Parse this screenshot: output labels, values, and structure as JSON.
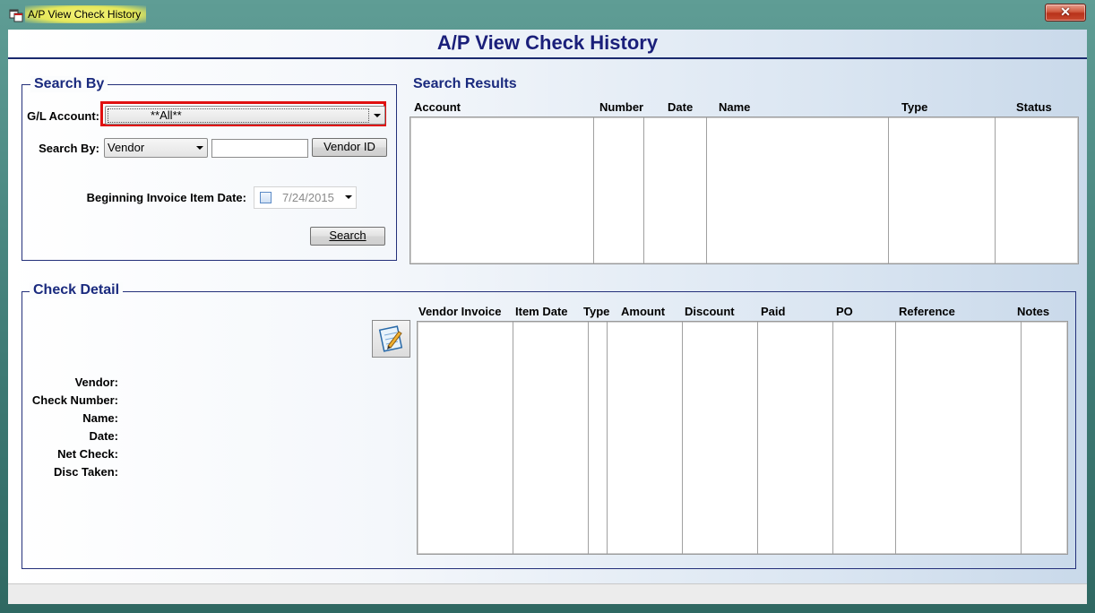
{
  "window": {
    "title": "A/P View Check History",
    "close_label": "✕",
    "close_icon": "close-icon",
    "app_icon": "window-icon"
  },
  "page": {
    "title": "A/P View Check History"
  },
  "search_by": {
    "group_title": "Search By",
    "gl_account_label": "G/L Account:",
    "gl_account_value": "**All**",
    "search_by_label": "Search By:",
    "search_by_value": "Vendor",
    "search_text_value": "",
    "vendor_id_button_label": "Vendor ID",
    "begin_date_label": "Beginning Invoice Item Date:",
    "begin_date_value": "7/24/2015",
    "begin_date_checked": false,
    "search_button_label": "Search",
    "highlight_color": "#e01010"
  },
  "search_results": {
    "title": "Search Results",
    "columns": [
      "Account",
      "Number",
      "Date",
      "Name",
      "Type",
      "Status"
    ],
    "rows": []
  },
  "check_detail": {
    "group_title": "Check Detail",
    "edit_icon": "notepad-edit-icon",
    "fields": {
      "vendor_label": "Vendor:",
      "check_number_label": "Check Number:",
      "name_label": "Name:",
      "date_label": "Date:",
      "net_check_label": "Net Check:",
      "disc_taken_label": "Disc Taken:"
    },
    "columns": [
      "Vendor Invoice",
      "Item Date",
      "Type",
      "Amount",
      "Discount",
      "Paid",
      "PO",
      "Reference",
      "Notes"
    ],
    "rows": []
  },
  "colors": {
    "title_color": "#1a1f7a",
    "group_border": "#24307a",
    "window_frame": "#3e7a74"
  }
}
